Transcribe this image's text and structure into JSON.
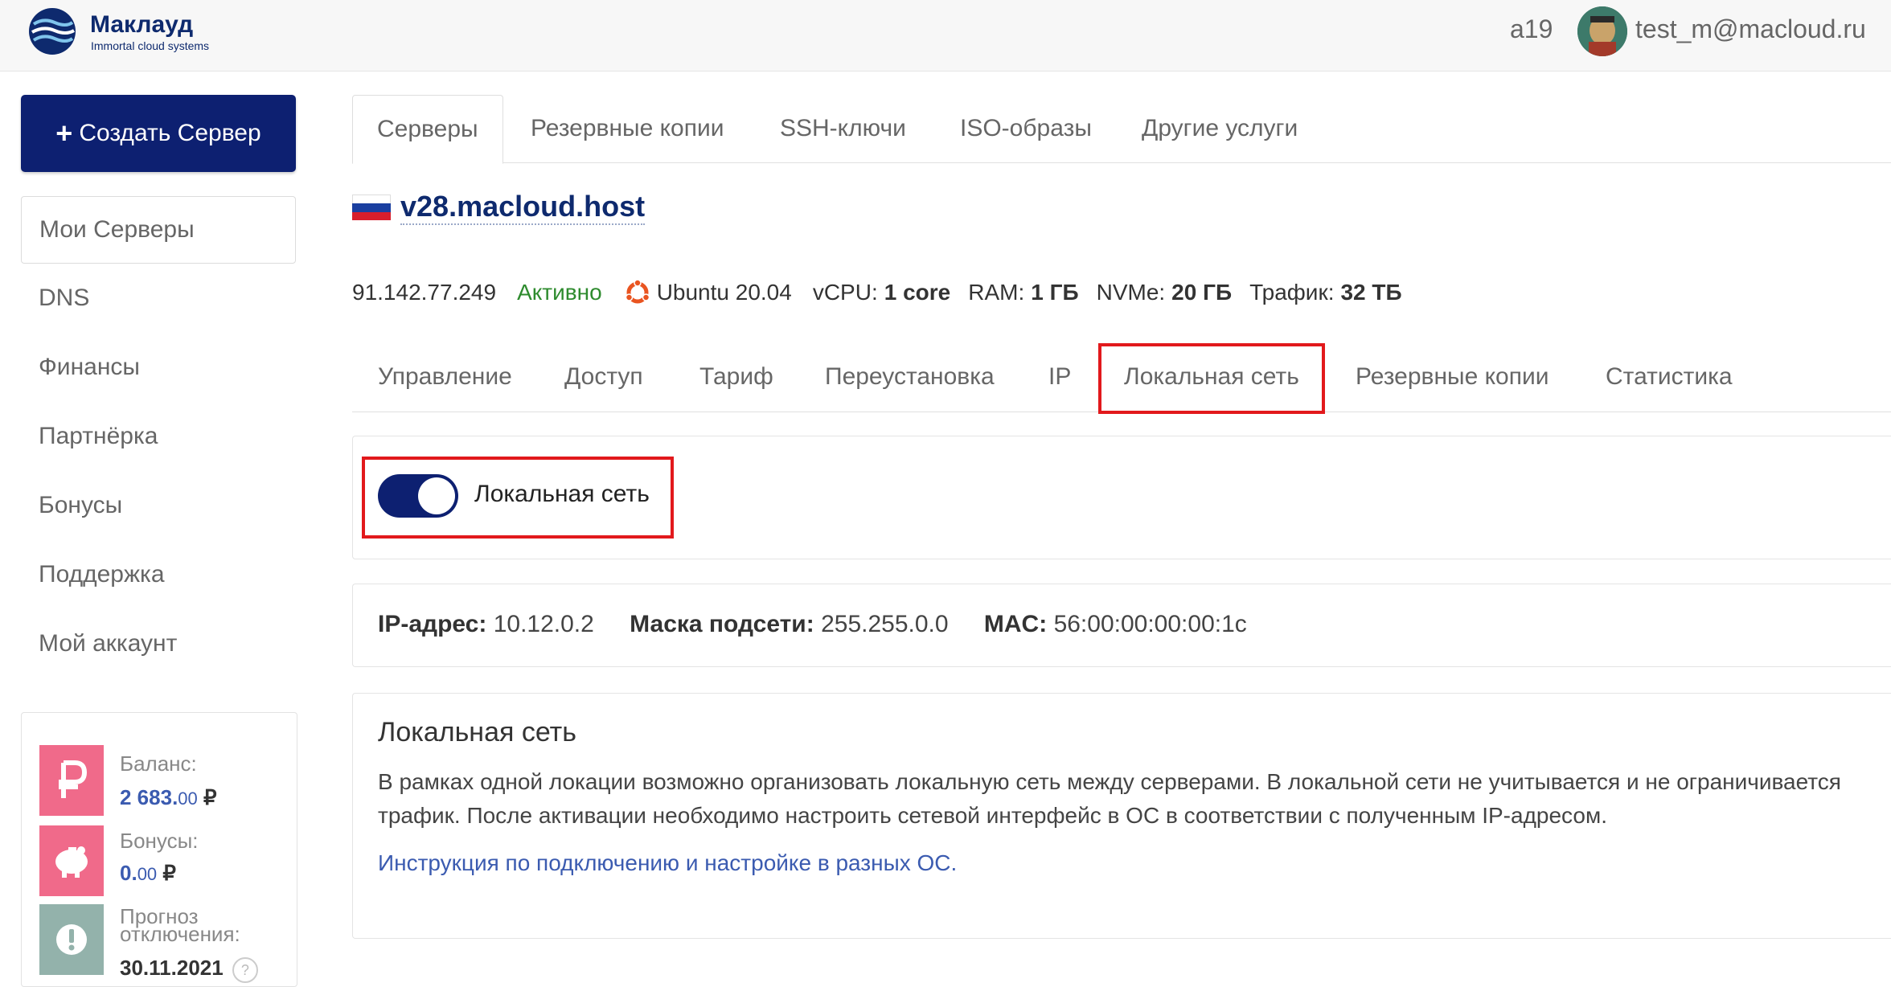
{
  "header": {
    "brand_name": "Маклауд",
    "brand_tagline": "Immortal cloud systems",
    "account_id": "a19",
    "user_email": "test_m@macloud.ru"
  },
  "sidebar": {
    "create_button": "Создать Сервер",
    "items": [
      {
        "label": "Мои Серверы",
        "active": true
      },
      {
        "label": "DNS"
      },
      {
        "label": "Финансы"
      },
      {
        "label": "Партнёрка"
      },
      {
        "label": "Бонусы"
      },
      {
        "label": "Поддержка"
      },
      {
        "label": "Мой аккаунт"
      }
    ],
    "finance": {
      "balance_label": "Баланс:",
      "balance_int": "2 683.",
      "balance_dec": "00",
      "currency": "₽",
      "bonus_label": "Бонусы:",
      "bonus_int": "0.",
      "bonus_dec": "00",
      "forecast_label_1": "Прогноз",
      "forecast_label_2": "отключения:",
      "forecast_date": "30.11.2021",
      "help": "?"
    }
  },
  "main": {
    "top_tabs": [
      "Серверы",
      "Резервные копии",
      "SSH-ключи",
      "ISO-образы",
      "Другие услуги"
    ],
    "server": {
      "name": "v28.macloud.host",
      "ip": "91.142.77.249",
      "status": "Активно",
      "os": "Ubuntu 20.04",
      "vcpu_label": "vCPU:",
      "vcpu_value": "1 core",
      "ram_label": "RAM:",
      "ram_value": "1 ГБ",
      "nvme_label": "NVMe:",
      "nvme_value": "20 ГБ",
      "traffic_label": "Трафик:",
      "traffic_value": "32 ТБ"
    },
    "sub_tabs": [
      "Управление",
      "Доступ",
      "Тариф",
      "Переустановка",
      "IP",
      "Локальная сеть",
      "Резервные копии",
      "Статистика"
    ],
    "local_network": {
      "toggle_label": "Локальная сеть",
      "toggle_on": true,
      "ip_label": "IP-адрес:",
      "ip_value": "10.12.0.2",
      "mask_label": "Маска подсети:",
      "mask_value": "255.255.0.0",
      "mac_label": "MAC:",
      "mac_value": "56:00:00:00:00:1c",
      "title": "Локальная сеть",
      "description": "В рамках одной локации возможно организовать локальную сеть между серверами. В локальной сети не учитывается и не ограничивается трафик. После активации необходимо настроить сетевой интерфейс в ОС в соответствии с полученным IP-адресом.",
      "link": "Инструкция по подключению и настройке в разных ОС."
    }
  },
  "colors": {
    "primary": "#0d2071",
    "status_active": "#2e8b2e",
    "highlight": "#e2191c",
    "finance_icon": "#f06a8a",
    "forecast_icon": "#93b2ab",
    "link": "#3b5bb0"
  }
}
